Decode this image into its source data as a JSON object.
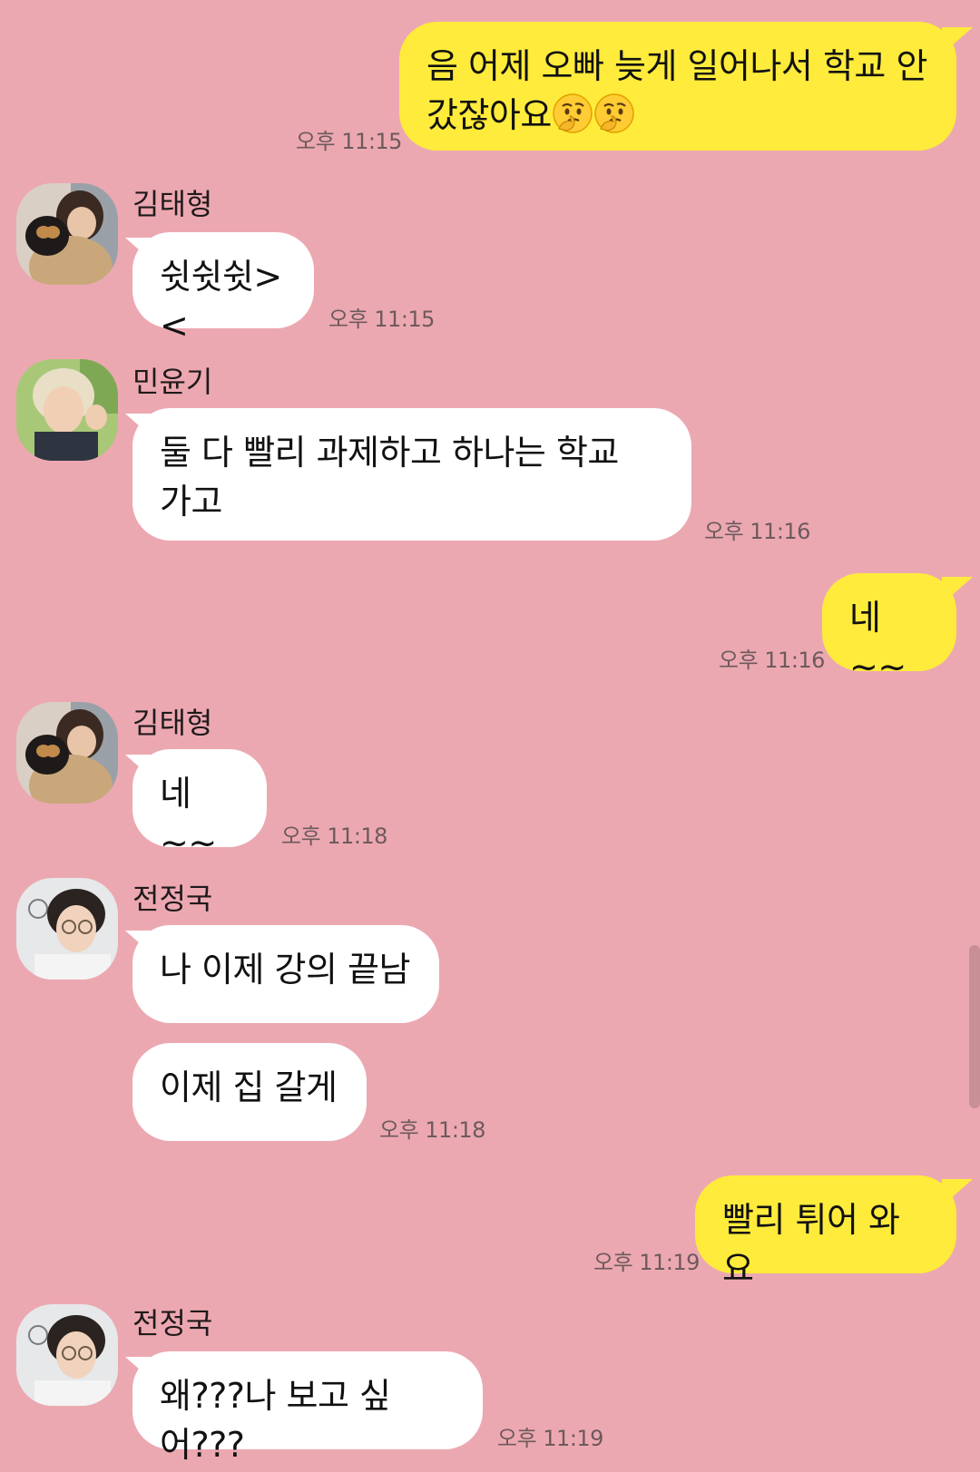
{
  "messages": [
    {
      "text": "음 어제 오빠 늦게 일어나서 학교 안 갔잖아요",
      "time": "오후 11:15"
    },
    {
      "sender": "김태형",
      "text": "쉿쉿쉿><",
      "time": "오후 11:15"
    },
    {
      "sender": "민윤기",
      "text_l1": "둘 다 빨리 과제하고 하나는 학교",
      "text_l2": "가고",
      "time": "오후 11:16"
    },
    {
      "text": "네~~",
      "time": "오후 11:16"
    },
    {
      "sender": "김태형",
      "text": "네~~",
      "time": "오후 11:18"
    },
    {
      "sender": "전정국",
      "text_a": "나 이제 강의 끝남",
      "text_b": "이제 집 갈게",
      "time": "오후 11:18"
    },
    {
      "text": "빨리 튀어 와요",
      "time": "오후 11:19"
    },
    {
      "sender": "전정국",
      "text": "왜???나 보고 싶어???",
      "time": "오후 11:19"
    }
  ],
  "icons": {
    "emoji": "thinking-face-emoji",
    "avatar_taehyung": "avatar-taehyung",
    "avatar_yoongi": "avatar-yoongi",
    "avatar_jungkook": "avatar-jungkook"
  },
  "colors": {
    "background": "#eca8b1",
    "my_bubble": "#ffeb3b",
    "their_bubble": "#ffffff"
  }
}
